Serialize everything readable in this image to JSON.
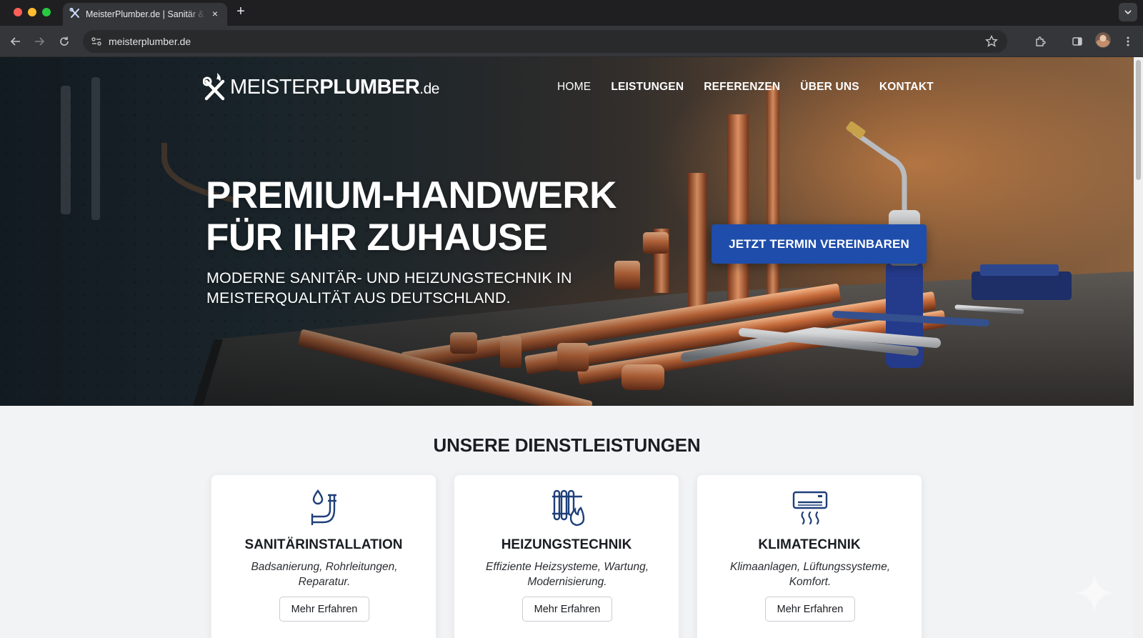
{
  "browser": {
    "tab_title": "MeisterPlumber.de | Sanitär & Heizung",
    "tab_close": "×",
    "new_tab": "+",
    "url": "meisterplumber.de"
  },
  "site": {
    "logo": {
      "part1": "MEISTER",
      "part2": "PLUMBER",
      "part3": ".de"
    },
    "nav": [
      "HOME",
      "LEISTUNGEN",
      "REFERENZEN",
      "ÜBER UNS",
      "KONTAKT"
    ],
    "hero": {
      "title_line1": "PREMIUM-HANDWERK",
      "title_line2": "FÜR IHR ZUHAUSE",
      "subtitle_line1": "MODERNE SANITÄR- UND HEIZUNGSTECHNIK IN",
      "subtitle_line2": "MEISTERQUALITÄT AUS DEUTSCHLAND.",
      "cta": "JETZT TERMIN VEREINBAREN"
    },
    "services": {
      "title": "UNSERE DIENSTLEISTUNGEN",
      "cards": [
        {
          "title": "SANITÄRINSTALLATION",
          "desc_line1": "Badsanierung, Rohrleitungen,",
          "desc_line2": "Reparatur.",
          "button": "Mehr Erfahren",
          "icon": "pipe-drop-icon"
        },
        {
          "title": "HEIZUNGSTECHNIK",
          "desc_line1": "Effiziente Heizsysteme, Wartung,",
          "desc_line2": "Modernisierung.",
          "button": "Mehr Erfahren",
          "icon": "radiator-flame-icon"
        },
        {
          "title": "KLIMATECHNIK",
          "desc_line1": "Klimaanlagen, Lüftungssysteme,",
          "desc_line2": "Komfort.",
          "button": "Mehr Erfahren",
          "icon": "air-conditioner-icon"
        }
      ]
    }
  },
  "colors": {
    "accent": "#1e4dab",
    "icon": "#1f3f7a"
  }
}
